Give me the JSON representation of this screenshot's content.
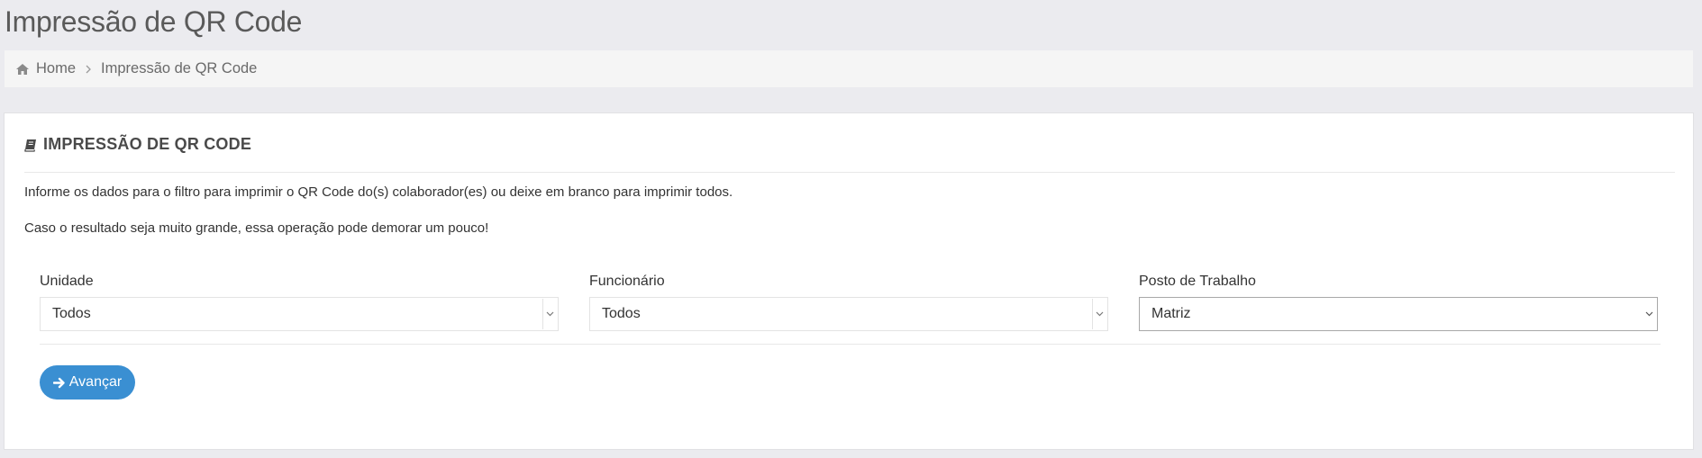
{
  "page": {
    "title": "Impressão de QR Code"
  },
  "breadcrumb": {
    "home": "Home",
    "current": "Impressão de QR Code"
  },
  "panel": {
    "title": "IMPRESSÃO DE QR CODE",
    "info_line_1": "Informe os dados para o filtro para imprimir o QR Code do(s) colaborador(es) ou deixe em branco para imprimir todos.",
    "info_line_2": "Caso o resultado seja muito grande, essa operação pode demorar um pouco!"
  },
  "filters": {
    "unidade": {
      "label": "Unidade",
      "value": "Todos"
    },
    "funcionario": {
      "label": "Funcionário",
      "value": "Todos"
    },
    "posto": {
      "label": "Posto de Trabalho",
      "value": "Matriz"
    }
  },
  "actions": {
    "advance_label": "Avançar"
  },
  "icons": {
    "home": "home-icon",
    "book": "book-icon",
    "chevron": "chevron-down-icon",
    "arrow": "arrow-right-icon"
  },
  "colors": {
    "primary": "#3a8fd2",
    "background": "#ebebef"
  }
}
